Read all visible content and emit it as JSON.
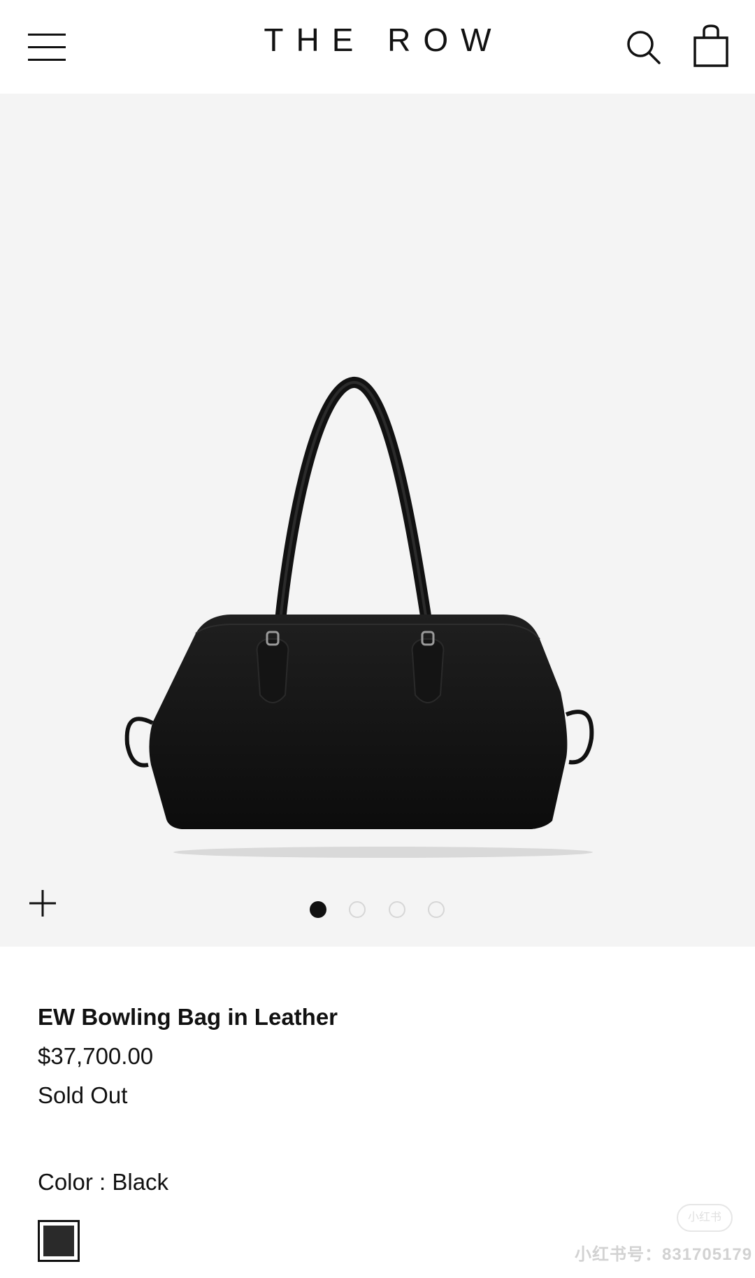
{
  "header": {
    "brand": "THE ROW",
    "menu_icon": "hamburger-menu-icon",
    "search_icon": "search-icon",
    "cart_icon": "shopping-bag-icon"
  },
  "gallery": {
    "image_alt": "EW Bowling Bag in Leather",
    "zoom_icon": "plus-icon",
    "slides_total": 4,
    "active_slide": 1
  },
  "product": {
    "name": "EW Bowling Bag in Leather",
    "price": "$37,700.00",
    "availability": "Sold Out",
    "color_label": "Color : Black",
    "swatch_color": "#2a2a2a"
  },
  "watermark": {
    "text": "小红书号：831705179",
    "logo_text": "小红书"
  },
  "colors": {
    "background": "#ffffff",
    "gallery_bg": "#f4f4f4",
    "text": "#111111"
  }
}
